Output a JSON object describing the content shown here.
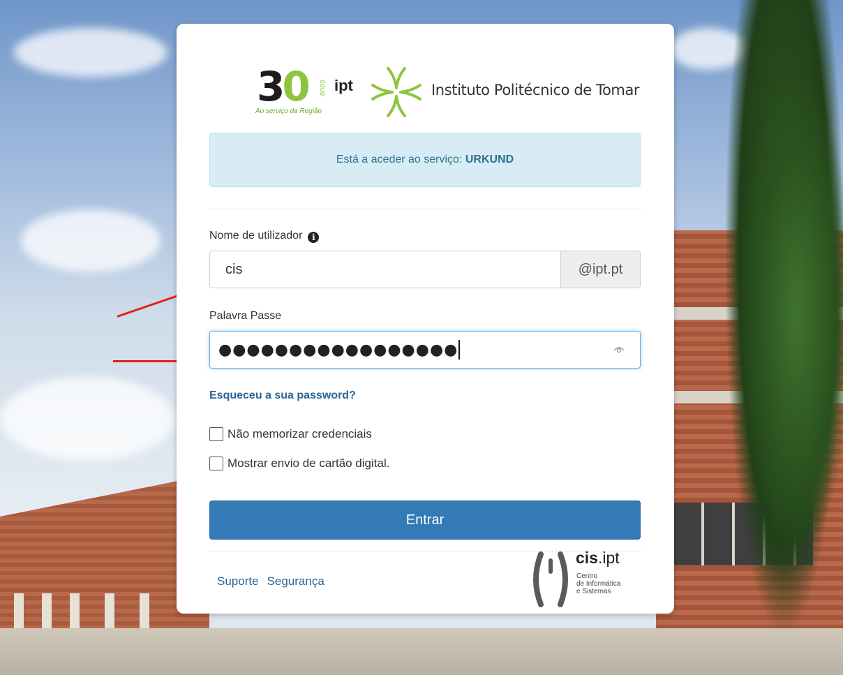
{
  "logo": {
    "thirty_digit": "3",
    "thirty_zero": "0",
    "anos": "anos",
    "tagline": "Ao serviço da Região",
    "short_name": "ipt",
    "institution_name": "Instituto Politécnico de Tomar"
  },
  "service_notice": {
    "prefix": "Está a aceder ao serviço: ",
    "service_name": "URKUND"
  },
  "username": {
    "label": "Nome de utilizador",
    "value": "cis",
    "domain_suffix": "@ipt.pt",
    "info_icon": "i"
  },
  "password": {
    "label": "Palavra Passe",
    "masked_value": "●●●●●●●●●●●●●●●●●"
  },
  "forgot_password_link": "Esqueceu a sua password?",
  "options": {
    "no_remember_label": "Não memorizar credenciais",
    "show_digital_card_label": "Mostrar envio de cartão digital."
  },
  "submit_label": "Entrar",
  "footer": {
    "support_link": "Suporte",
    "security_link": "Segurança",
    "cis_logo": {
      "name_bold": "cis",
      "name_rest": ".ipt",
      "line1": "Centro",
      "line2": "de Informática",
      "line3": "e Sistemas"
    }
  },
  "colors": {
    "primary": "#337ab7",
    "link": "#2a6496",
    "notice_bg": "#d8ecf5",
    "notice_text": "#31708f",
    "logo_green": "#8cc63f",
    "annotation_arrow": "#e31e1e"
  }
}
